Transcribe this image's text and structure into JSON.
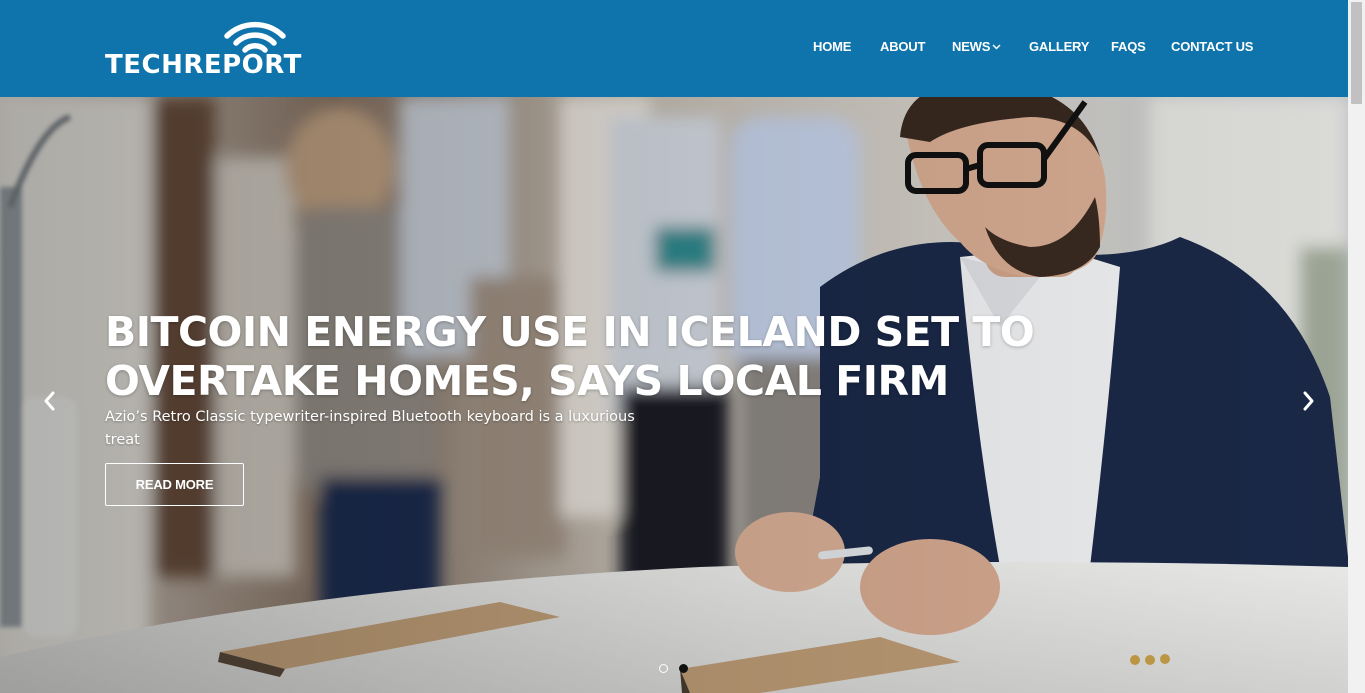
{
  "brand": {
    "name": "TECHREPORT"
  },
  "nav": {
    "items": [
      {
        "label": "HOME"
      },
      {
        "label": "ABOUT"
      },
      {
        "label": "NEWS",
        "has_dropdown": true
      },
      {
        "label": "GALLERY"
      },
      {
        "label": "FAQS"
      },
      {
        "label": "CONTACT US"
      }
    ]
  },
  "hero": {
    "headline": "BITCOIN ENERGY USE IN ICELAND SET TO OVERTAKE HOMES, SAYS LOCAL FIRM",
    "subline": "Azio’s Retro Classic typewriter-inspired Bluetooth keyboard is a luxurious treat",
    "button_label": "READ MORE",
    "slides_total": 2,
    "active_slide": 2
  },
  "icons": {
    "logo_mark": "wifi-signal-icon",
    "dropdown": "chevron-down-icon",
    "prev": "chevron-left-icon",
    "next": "chevron-right-icon"
  },
  "colors": {
    "header_bg": "#0f74ab",
    "text_light": "#ffffff",
    "dot_active": "#111111"
  }
}
